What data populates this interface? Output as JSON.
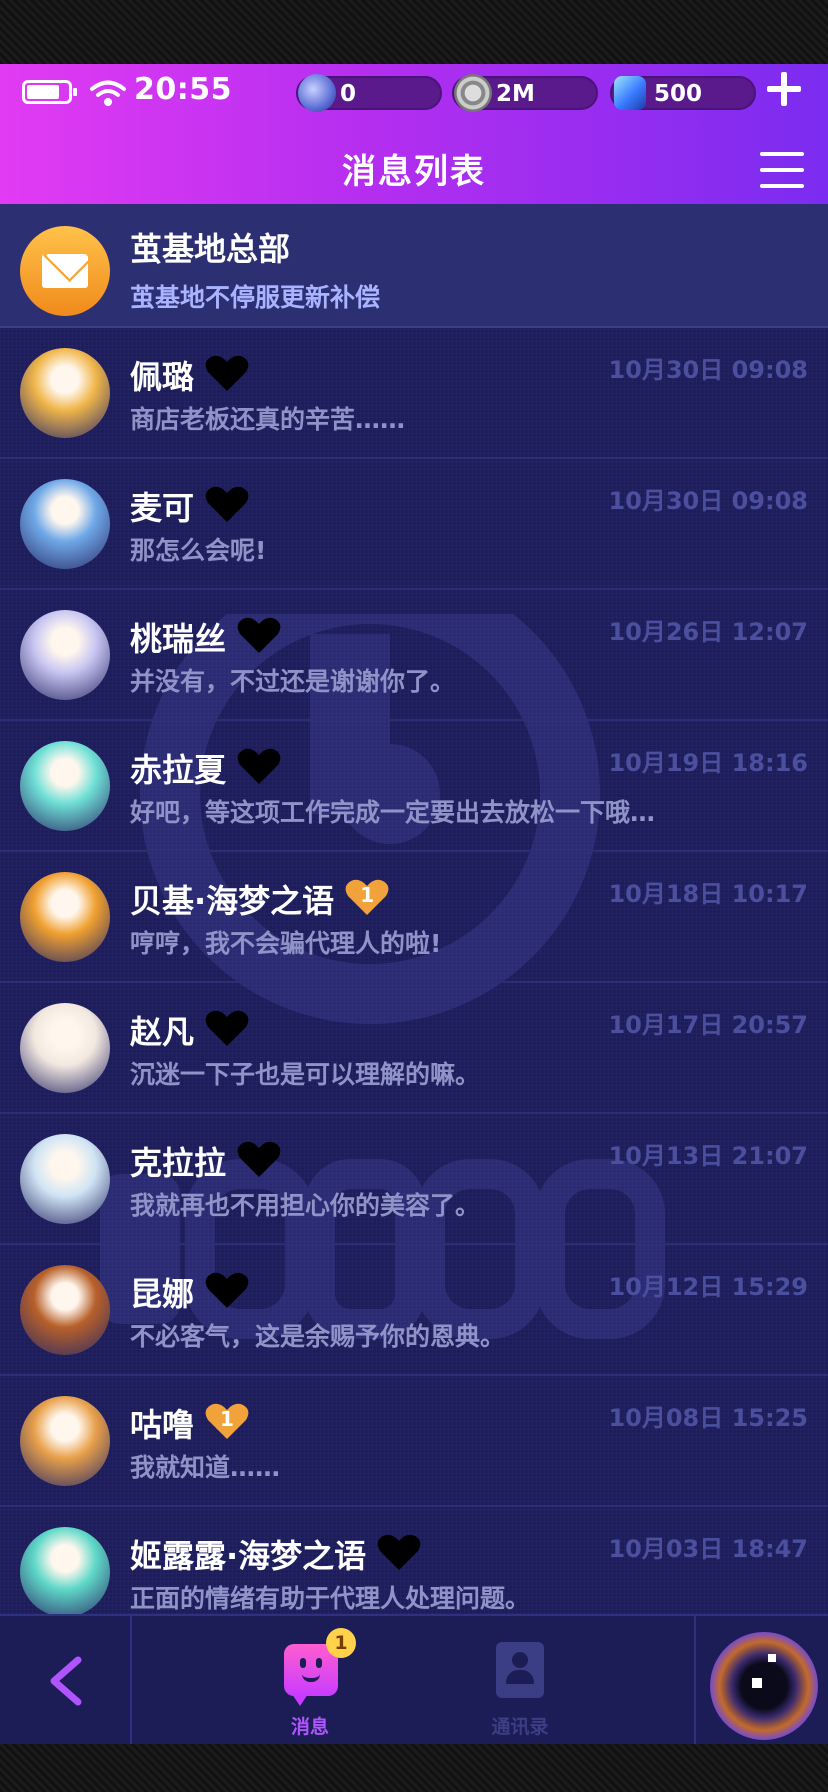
{
  "status": {
    "time": "20:55"
  },
  "resources": {
    "energy": "0",
    "coins": "2M",
    "gems": "500"
  },
  "header": {
    "title": "消息列表"
  },
  "system_item": {
    "name": "茧基地总部",
    "message": "茧基地不停服更新补偿"
  },
  "messages": [
    {
      "name": "佩璐",
      "time": "10月30日 09:08",
      "message": "商店老板还真的辛苦……",
      "heart": "black",
      "avatar_color": "#f0b64a"
    },
    {
      "name": "麦可",
      "time": "10月30日 09:08",
      "message": "那怎么会呢!",
      "heart": "black",
      "avatar_color": "#6fa8e8"
    },
    {
      "name": "桃瑞丝",
      "time": "10月26日 12:07",
      "message": "并没有，不过还是谢谢你了。",
      "heart": "black",
      "avatar_color": "#c9c6f2"
    },
    {
      "name": "赤拉夏",
      "time": "10月19日 18:16",
      "message": "好吧，等这项工作完成一定要出去放松一下哦…",
      "heart": "black",
      "avatar_color": "#6fe0d6"
    },
    {
      "name": "贝基·海梦之语",
      "time": "10月18日 10:17",
      "message": "哼哼，我不会骗代理人的啦!",
      "heart": "gold",
      "heart_level": "1",
      "avatar_color": "#f0a030"
    },
    {
      "name": "赵凡",
      "time": "10月17日 20:57",
      "message": "沉迷一下子也是可以理解的嘛。",
      "heart": "black",
      "avatar_color": "#f2e8e0"
    },
    {
      "name": "克拉拉",
      "time": "10月13日 21:07",
      "message": "我就再也不用担心你的美容了。",
      "heart": "black",
      "avatar_color": "#cfe4f4"
    },
    {
      "name": "昆娜",
      "time": "10月12日 15:29",
      "message": "不必客气，这是余赐予你的恩典。",
      "heart": "black",
      "avatar_color": "#b8602a"
    },
    {
      "name": "咕噜",
      "time": "10月08日 15:25",
      "message": "我就知道……",
      "heart": "gold",
      "heart_level": "1",
      "avatar_color": "#e8a04a"
    },
    {
      "name": "姬露露·海梦之语",
      "time": "10月03日 18:47",
      "message": "正面的情绪有助于代理人处理问题。",
      "heart": "black",
      "avatar_color": "#5fd8c8"
    }
  ],
  "nav": {
    "messages_label": "消息",
    "messages_badge": "1",
    "contacts_label": "通讯录"
  },
  "colors": {
    "header_start": "#e23bf3",
    "header_end": "#7b2cf0",
    "background": "#1d1d5c",
    "accent": "#b054ff"
  }
}
